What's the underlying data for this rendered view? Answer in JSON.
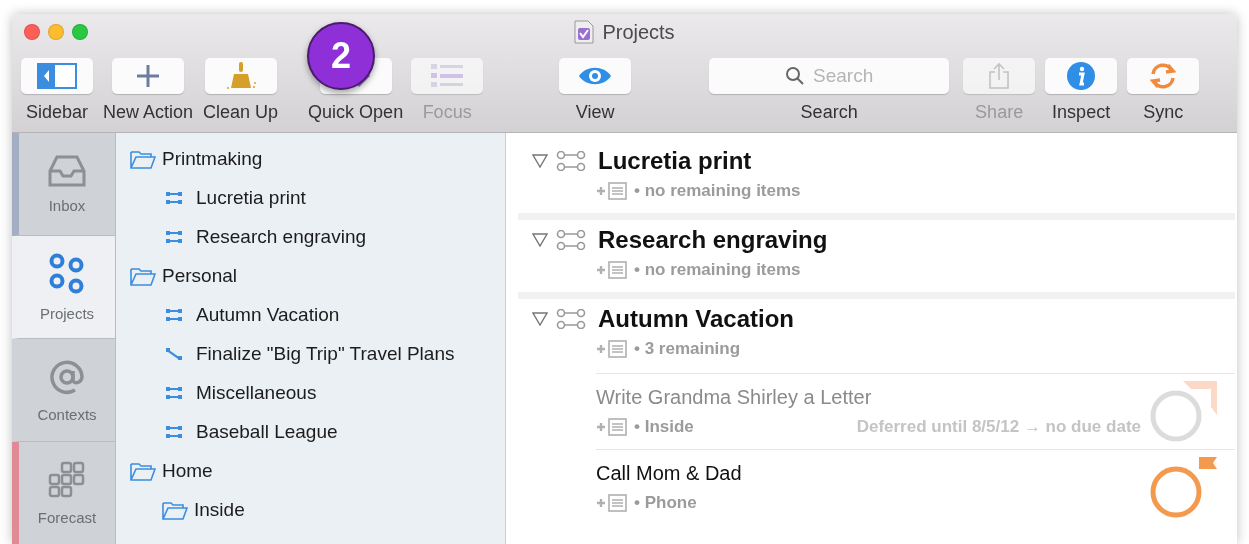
{
  "window": {
    "title": "Projects"
  },
  "callout": {
    "label": "2"
  },
  "toolbar": {
    "items": [
      {
        "kind": "sidebar",
        "label": "Sidebar",
        "disabled": false
      },
      {
        "kind": "add",
        "label": "New Action",
        "disabled": false
      },
      {
        "kind": "cleanup",
        "label": "Clean Up",
        "disabled": false
      },
      {
        "kind": "quickopen",
        "label": "Quick Open",
        "disabled": false
      },
      {
        "kind": "focus",
        "label": "Focus",
        "disabled": true
      },
      {
        "kind": "view",
        "label": "View",
        "disabled": false
      },
      {
        "kind": "search",
        "label": "Search",
        "placeholder": "Search",
        "disabled": false
      },
      {
        "kind": "share",
        "label": "Share",
        "disabled": true
      },
      {
        "kind": "inspect",
        "label": "Inspect",
        "disabled": false
      },
      {
        "kind": "sync",
        "label": "Sync",
        "disabled": false
      }
    ]
  },
  "sidebar": {
    "tabs": [
      {
        "kind": "inbox",
        "label": "Inbox",
        "selected": false,
        "color": "#a3aec4"
      },
      {
        "kind": "projects",
        "label": "Projects",
        "selected": true
      },
      {
        "kind": "contexts",
        "label": "Contexts",
        "selected": false
      },
      {
        "kind": "forecast",
        "label": "Forecast",
        "selected": false,
        "color": "#e08a96"
      }
    ]
  },
  "outline": {
    "items": [
      {
        "kind": "folder",
        "label": "Printmaking",
        "children": [
          {
            "kind": "project",
            "label": "Lucretia print"
          },
          {
            "kind": "project",
            "label": "Research engraving"
          }
        ]
      },
      {
        "kind": "folder",
        "label": "Personal",
        "children": [
          {
            "kind": "project",
            "label": "Autumn Vacation"
          },
          {
            "kind": "single",
            "label": "Finalize \"Big Trip\" Travel Plans"
          },
          {
            "kind": "project",
            "label": "Miscellaneous"
          },
          {
            "kind": "project",
            "label": "Baseball League"
          }
        ]
      },
      {
        "kind": "folder",
        "label": "Home",
        "children": [
          {
            "kind": "folder",
            "label": "Inside"
          }
        ]
      }
    ]
  },
  "projects": [
    {
      "title": "Lucretia print",
      "expanded": true,
      "status": "• no remaining items"
    },
    {
      "title": "Research engraving",
      "expanded": true,
      "status": "• no remaining items"
    },
    {
      "title": "Autumn Vacation",
      "expanded": true,
      "status": "• 3 remaining",
      "actions": [
        {
          "title": "Write Grandma Shirley a Letter",
          "context": "• Inside",
          "deferred": "Deferred until 8/5/12 → no due date",
          "dimmed": true,
          "flagged": true
        },
        {
          "title": "Call Mom & Dad",
          "context": "• Phone",
          "dimmed": false,
          "flagged": true
        }
      ]
    }
  ]
}
